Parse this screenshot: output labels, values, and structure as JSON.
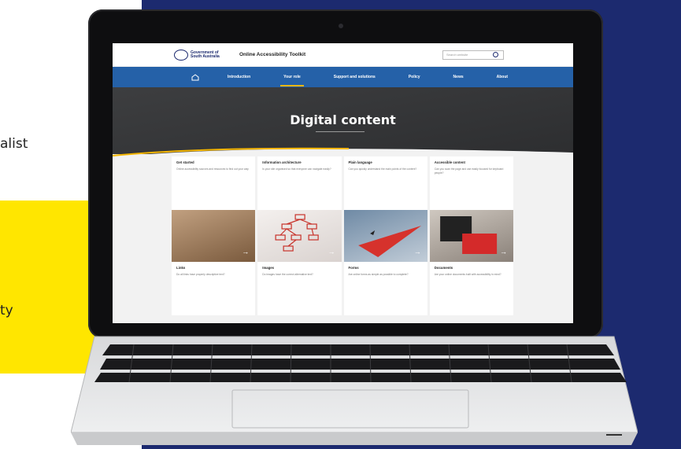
{
  "side_text": {
    "line1": "alist",
    "line2": "ty"
  },
  "site": {
    "gov_name": "Government of South Australia",
    "title": "Online Accessibility Toolkit",
    "search_placeholder": "Search website"
  },
  "nav": {
    "items": [
      "Introduction",
      "Your role",
      "Support and solutions",
      "Policy",
      "News",
      "About"
    ],
    "active": "Your role"
  },
  "hero": {
    "title": "Digital content"
  },
  "cards_top": [
    {
      "title": "Get started",
      "desc": "Online accessibility sources and resources to find out your way"
    },
    {
      "title": "Information architecture",
      "desc": "Is your site organised so that everyone can navigate easily?"
    },
    {
      "title": "Plain language",
      "desc": "Can you quickly understand the main points of the content?"
    },
    {
      "title": "Accessible content",
      "desc": "Can you scan the page and use easily focused for keyboard people?"
    }
  ],
  "cards_bottom": [
    {
      "title": "Links",
      "desc": "Do all links have properly descriptive text?"
    },
    {
      "title": "Images",
      "desc": "Do images have the correct alternative text?"
    },
    {
      "title": "Forms",
      "desc": "Are online forms as simple as possible to complete?"
    },
    {
      "title": "Documents",
      "desc": "Are your online documents built with accessibility in mind?"
    }
  ],
  "colors": {
    "navy": "#1c2a6f",
    "yellow": "#ffe600",
    "nav_blue": "#2561a8",
    "accent": "#f5b600"
  }
}
